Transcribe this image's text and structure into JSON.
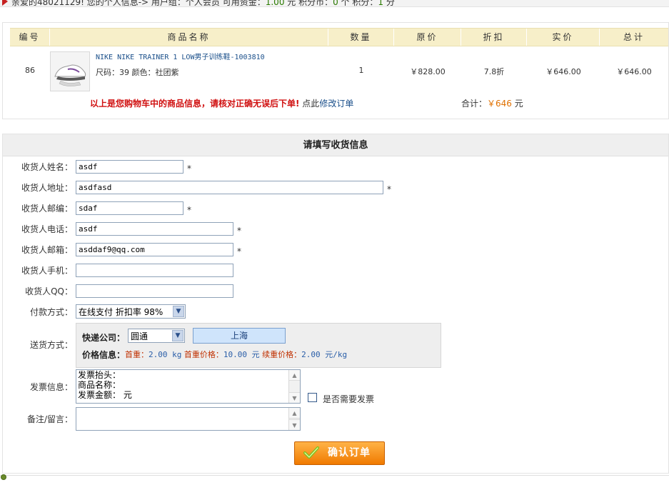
{
  "user_bar": {
    "text": "亲爱的48021129! 您的个人信息-> 用户组：个人会员 可用资金：",
    "funds": "1.00",
    "funds_unit": " 元  积分币：",
    "coins": "0",
    "coins_unit": " 个  积分：",
    "points": "1",
    "points_unit": " 分"
  },
  "cart": {
    "headers": [
      "编号",
      "商品名称",
      "数量",
      "原价",
      "折扣",
      "实价",
      "总计"
    ],
    "item": {
      "no": "86",
      "name": "NIKE NIKE TRAINER 1 LOW男子训练鞋-1003810",
      "spec": "尺码：39 颜色：社团紫",
      "qty": "1",
      "original_price": "￥828.00",
      "discount": "7.8折",
      "real_price": "￥646.00",
      "total": "￥646.00"
    },
    "note_warn": "以上是您购物车中的商品信息，请核对正确无误后下单!",
    "note_link_prefix": " 点此",
    "note_link": "修改订单",
    "sum_label": "合计：",
    "sum_value": "￥646",
    "sum_unit": " 元"
  },
  "form": {
    "title": "请填写收货信息",
    "name_label": "收货人姓名：",
    "name_value": "asdf",
    "address_label": "收货人地址：",
    "address_value": "asdfasd",
    "zip_label": "收货人邮编：",
    "zip_value": "sdaf",
    "phone_label": "收货人电话：",
    "phone_value": "asdf",
    "email_label": "收货人邮箱：",
    "email_value": "asddaf9@qq.com",
    "mobile_label": "收货人手机：",
    "mobile_value": "",
    "qq_label": "收货人QQ：",
    "qq_value": "",
    "required_mark": "*",
    "payment_label": "付款方式：",
    "payment_value": "在线支付 折扣率 98%",
    "shipping_label": "送货方式：",
    "courier_label": "快递公司：",
    "courier_value": "圆通",
    "city": "上海",
    "price_info_label": "价格信息：",
    "first_weight_label": "首重：",
    "first_weight_value": "2.00 kg",
    "first_price_label": " 首重价格：",
    "first_price_value": "10.00 元",
    "extra_price_label": " 续重价格：",
    "extra_price_value": "2.00 元/kg",
    "invoice_label": "发票信息：",
    "invoice_lines": [
      "发票抬头：",
      "商品名称：",
      "发票金额：  元"
    ],
    "invoice_checkbox_label": "是否需要发票",
    "remark_label": "备注/留言：",
    "remark_value": "",
    "confirm_button": "确认订单"
  },
  "colors": {
    "header_bg": "#f7efc9",
    "warn": "#d01010",
    "link": "#1a4f8a",
    "price_key": "#c03000",
    "button_orange": "#f07a00",
    "city_bg": "#cfe4fb"
  },
  "icons": [
    "flag-icon",
    "product-thumbnail",
    "dropdown-arrow-icon",
    "scroll-up-icon",
    "scroll-down-icon",
    "check-icon"
  ]
}
